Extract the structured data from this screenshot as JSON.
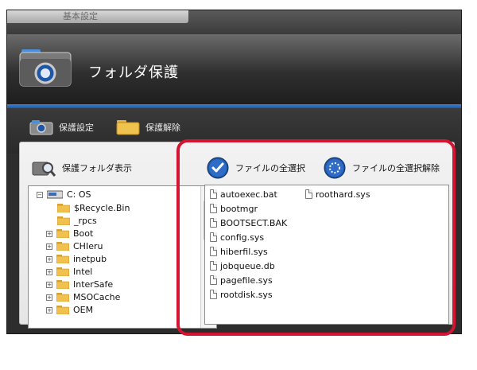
{
  "window": {
    "tab_label": "基本設定",
    "title": "フォルダ保護"
  },
  "toolbar": {
    "protect_settings_label": "保護設定",
    "protect_release_label": "保護解除"
  },
  "panel": {
    "show_protected_folders_label": "保護フォルダ表示",
    "select_all_files_label": "ファイルの全選択",
    "deselect_all_files_label": "ファイルの全選択解除"
  },
  "tree": {
    "root": "C: OS",
    "items": [
      {
        "label": "$Recycle.Bin",
        "expandable": false
      },
      {
        "label": "_rpcs",
        "expandable": false
      },
      {
        "label": "Boot",
        "expandable": true
      },
      {
        "label": "CHIeru",
        "expandable": true
      },
      {
        "label": "inetpub",
        "expandable": true
      },
      {
        "label": "Intel",
        "expandable": true
      },
      {
        "label": "InterSafe",
        "expandable": true
      },
      {
        "label": "MSOCache",
        "expandable": true
      },
      {
        "label": "OEM",
        "expandable": true
      }
    ]
  },
  "files": {
    "column1": [
      "autoexec.bat",
      "bootmgr",
      "BOOTSECT.BAK",
      "config.sys",
      "hiberfil.sys",
      "jobqueue.db",
      "pagefile.sys",
      "rootdisk.sys"
    ],
    "column2": [
      "roothard.sys"
    ]
  },
  "colors": {
    "highlight": "#d41431",
    "accent_blue": "#1f57a8"
  }
}
